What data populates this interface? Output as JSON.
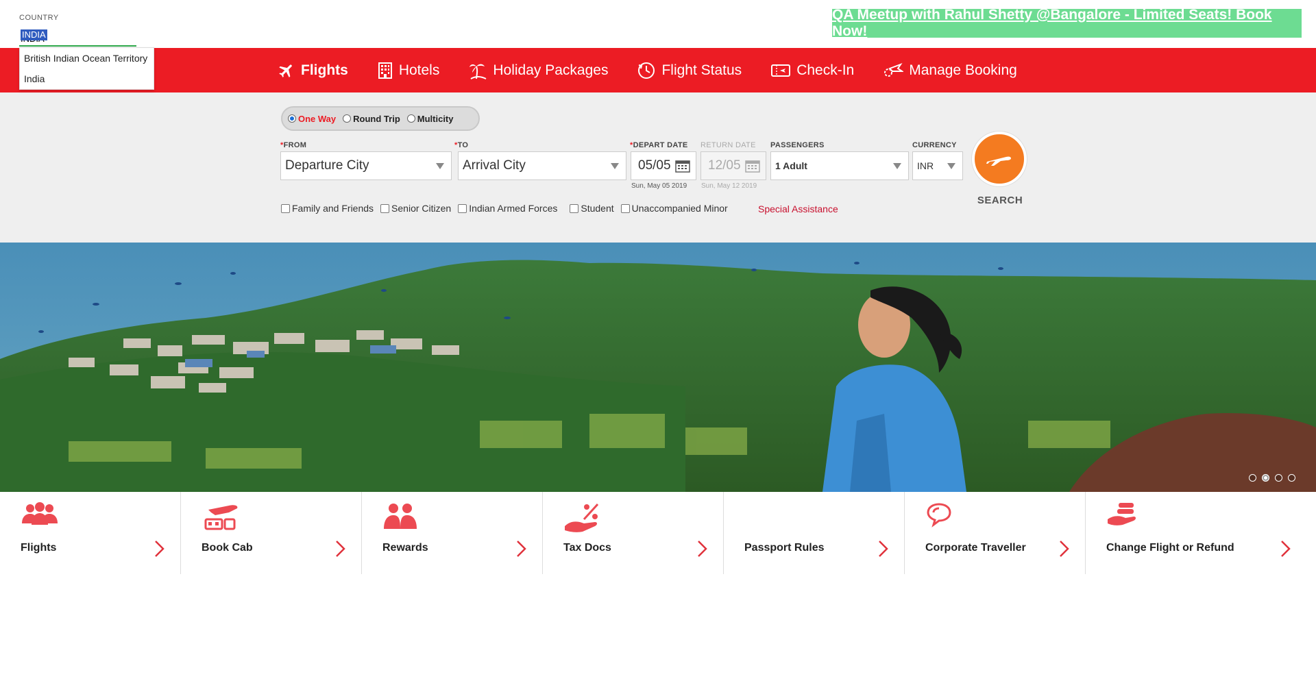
{
  "country": {
    "label": "COUNTRY",
    "value": "INDIA",
    "suggestions": [
      "British Indian Ocean Territory",
      "India"
    ]
  },
  "promo": {
    "text": "QA Meetup with Rahul Shetty @Bangalore - Limited Seats! Book Now!"
  },
  "nav": {
    "items": [
      {
        "label": "Flights",
        "icon": "plane-icon"
      },
      {
        "label": "Hotels",
        "icon": "hotel-icon"
      },
      {
        "label": "Holiday Packages",
        "icon": "palm-tree-icon"
      },
      {
        "label": "Flight Status",
        "icon": "clock-icon"
      },
      {
        "label": "Check-In",
        "icon": "ticket-icon"
      },
      {
        "label": "Manage Booking",
        "icon": "plane-cog-icon"
      }
    ]
  },
  "trip": {
    "options": [
      "One Way",
      "Round Trip",
      "Multicity"
    ],
    "selected": "One Way"
  },
  "form": {
    "from_label": "FROM",
    "from_value": "Departure City",
    "to_label": "TO",
    "to_value": "Arrival City",
    "depart_label": "DEPART DATE",
    "depart_value": "05/05",
    "depart_sub": "Sun, May 05 2019",
    "return_label": "RETURN DATE",
    "return_value": "12/05",
    "return_sub": "Sun, May 12 2019",
    "passengers_label": "PASSENGERS",
    "passengers_value": "1 Adult",
    "currency_label": "CURRENCY",
    "currency_value": "INR",
    "required_mark": "*",
    "search_label": "SEARCH"
  },
  "discounts": [
    "Family and Friends",
    "Senior Citizen",
    "Indian Armed Forces",
    "Student",
    "Unaccompanied Minor"
  ],
  "special_assistance": "Special Assistance",
  "tiles": [
    {
      "label": "Flights",
      "icon": "group-icon"
    },
    {
      "label": "Book Cab",
      "icon": "cab-icon"
    },
    {
      "label": "Rewards",
      "icon": "rewards-icon"
    },
    {
      "label": "Tax Docs",
      "icon": "tax-hand-icon"
    },
    {
      "label": "Passport Rules",
      "icon": "passport-icon"
    },
    {
      "label": "Corporate Traveller",
      "icon": "chat-icon"
    },
    {
      "label": "Change Flight or Refund",
      "icon": "refund-icon"
    }
  ],
  "carousel": {
    "count": 4,
    "active": 1
  },
  "colors": {
    "brand_red": "#ec1c24",
    "promo_green": "#6ddc92",
    "search_orange": "#f47b20"
  }
}
